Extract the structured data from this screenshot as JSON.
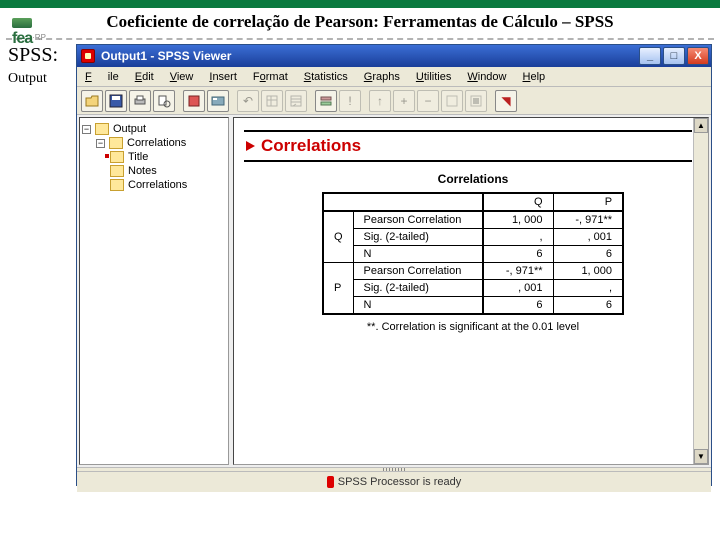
{
  "slide": {
    "title": "Coeficiente de correlação de Pearson: Ferramentas de Cálculo – SPSS"
  },
  "side": {
    "spss": "SPSS:",
    "output": "Output"
  },
  "window": {
    "title": "Output1 - SPSS Viewer",
    "menu": {
      "file": "File",
      "edit": "Edit",
      "view": "View",
      "insert": "Insert",
      "format": "Format",
      "statistics": "Statistics",
      "graphs": "Graphs",
      "utilities": "Utilities",
      "window": "Window",
      "help": "Help"
    }
  },
  "tree": {
    "n0": "Output",
    "n1": "Correlations",
    "n2": "Title",
    "n3": "Notes",
    "n4": "Correlations"
  },
  "content": {
    "heading": "Correlations",
    "table_title": "Correlations",
    "cols": {
      "q": "Q",
      "p": "P"
    },
    "rows": {
      "q": "Q",
      "p": "P",
      "pearson": "Pearson Correlation",
      "sig": "Sig. (2-tailed)",
      "n": "N"
    },
    "vals": {
      "qq": "1, 000",
      "qp": "-, 971**",
      "psig_q": ", 001",
      "n_q": "6",
      "pq": "-, 971**",
      "pp": "1, 000",
      "psig_p": ", 001",
      "n_p": "6",
      "sig_blank": ",",
      "n6": "6"
    },
    "footnote": "**. Correlation is significant at the 0.01 level"
  },
  "status": {
    "text": "SPSS Processor is ready"
  },
  "chart_data": {
    "type": "table",
    "title": "Correlations",
    "variables": [
      "Q",
      "P"
    ],
    "stats": [
      "Pearson Correlation",
      "Sig. (2-tailed)",
      "N"
    ],
    "matrix": {
      "Q": {
        "Q": {
          "pearson": 1.0,
          "sig": null,
          "n": 6
        },
        "P": {
          "pearson": -0.971,
          "sig": 0.001,
          "n": 6
        }
      },
      "P": {
        "Q": {
          "pearson": -0.971,
          "sig": 0.001,
          "n": 6
        },
        "P": {
          "pearson": 1.0,
          "sig": null,
          "n": 6
        }
      }
    },
    "note": "Correlation is significant at the 0.01 level"
  }
}
